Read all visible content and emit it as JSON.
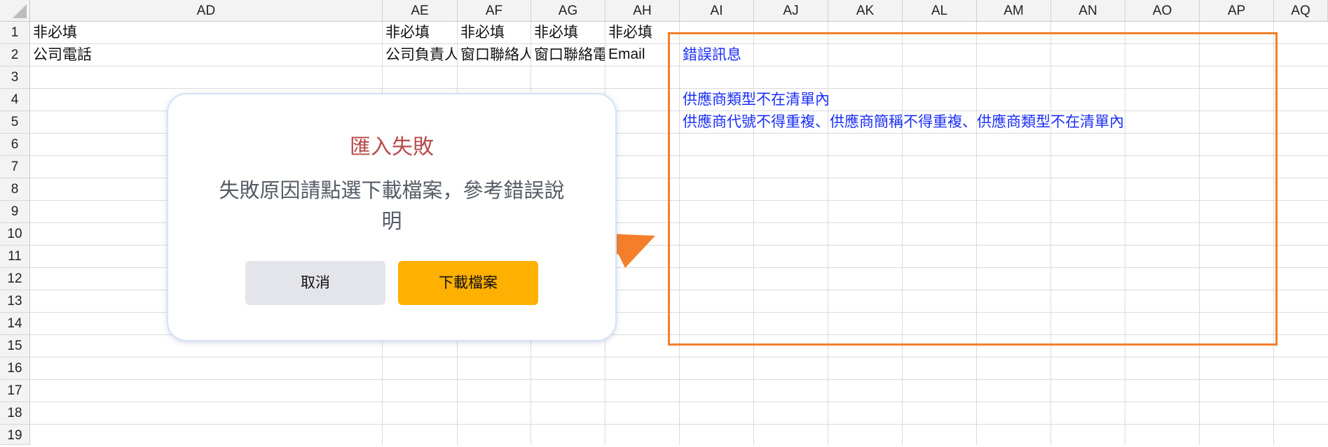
{
  "columns": [
    "AD",
    "AE",
    "AF",
    "AG",
    "AH",
    "AI",
    "AJ",
    "AK",
    "AL",
    "AM",
    "AN",
    "AO",
    "AP",
    "AQ"
  ],
  "rows": [
    "1",
    "2",
    "3",
    "4",
    "5",
    "6",
    "7",
    "8",
    "9",
    "10",
    "11",
    "12",
    "13",
    "14",
    "15",
    "16",
    "17",
    "18",
    "19"
  ],
  "cells": {
    "ad1": "非必填",
    "ae1": "非必填",
    "af1": "非必填",
    "ag1": "非必填",
    "ah1": "非必填",
    "ad2": "公司電話",
    "ae2": "公司負責人",
    "af2": "窗口聯絡人",
    "ag2": "窗口聯絡電話",
    "ah2": "Email",
    "ai2": "錯誤訊息",
    "ai4": "供應商類型不在清單內",
    "ai5": "供應商代號不得重複、供應商簡稱不得重複、供應商類型不在清單內"
  },
  "dialog": {
    "title": "匯入失敗",
    "message": "失敗原因請點選下載檔案，參考錯誤說明",
    "cancel_label": "取消",
    "download_label": "下載檔案"
  },
  "colors": {
    "accent_orange": "#f47f2a",
    "download_button": "#ffb000",
    "error_text_blue": "#1b2ff5",
    "dialog_title_red": "#b94b4b"
  }
}
